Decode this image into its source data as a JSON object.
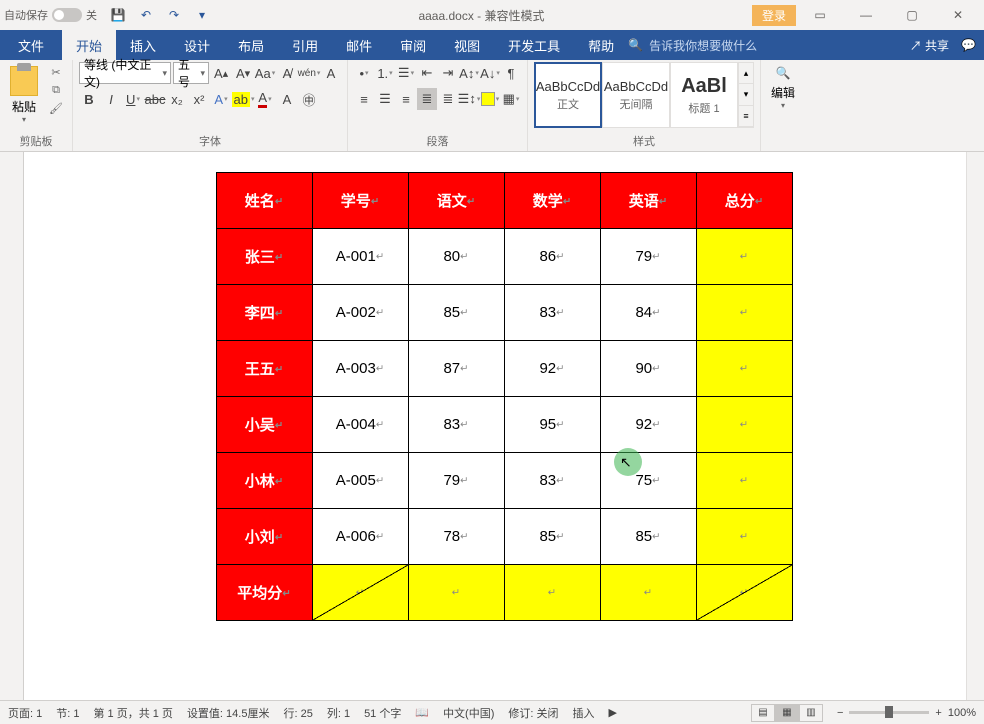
{
  "titlebar": {
    "autosave_label": "自动保存",
    "autosave_state": "关",
    "doc_name": "aaaa.docx",
    "doc_mode": "兼容性模式",
    "login": "登录"
  },
  "tabs": {
    "file": "文件",
    "home": "开始",
    "insert": "插入",
    "design": "设计",
    "layout": "布局",
    "references": "引用",
    "mailings": "邮件",
    "review": "审阅",
    "view": "视图",
    "developer": "开发工具",
    "help": "帮助",
    "tell_me": "告诉我你想要做什么",
    "share": "共享"
  },
  "ribbon": {
    "clipboard": {
      "paste": "粘贴",
      "label": "剪贴板"
    },
    "font": {
      "name": "等线 (中文正文)",
      "size": "五号",
      "label": "字体"
    },
    "paragraph": {
      "label": "段落"
    },
    "styles": {
      "label": "样式",
      "preview": "AaBbCcDd",
      "preview_big": "AaBl",
      "items": [
        "正文",
        "无间隔",
        "标题 1"
      ]
    },
    "editing": {
      "label": "编辑"
    }
  },
  "table": {
    "headers": [
      "姓名",
      "学号",
      "语文",
      "数学",
      "英语",
      "总分"
    ],
    "rows": [
      {
        "name": "张三",
        "id": "A-001",
        "chinese": "80",
        "math": "86",
        "english": "79",
        "total": ""
      },
      {
        "name": "李四",
        "id": "A-002",
        "chinese": "85",
        "math": "83",
        "english": "84",
        "total": ""
      },
      {
        "name": "王五",
        "id": "A-003",
        "chinese": "87",
        "math": "92",
        "english": "90",
        "total": ""
      },
      {
        "name": "小吴",
        "id": "A-004",
        "chinese": "83",
        "math": "95",
        "english": "92",
        "total": ""
      },
      {
        "name": "小林",
        "id": "A-005",
        "chinese": "79",
        "math": "83",
        "english": "75",
        "total": ""
      },
      {
        "name": "小刘",
        "id": "A-006",
        "chinese": "78",
        "math": "85",
        "english": "85",
        "total": ""
      }
    ],
    "avg_label": "平均分"
  },
  "statusbar": {
    "page": "页面: 1",
    "section": "节: 1",
    "page_of": "第 1 页，共 1 页",
    "at": "设置值: 14.5厘米",
    "line": "行: 25",
    "col": "列: 1",
    "words": "51 个字",
    "lang": "中文(中国)",
    "track": "修订: 关闭",
    "insert": "插入",
    "zoom": "100%"
  },
  "pmark": "↵"
}
